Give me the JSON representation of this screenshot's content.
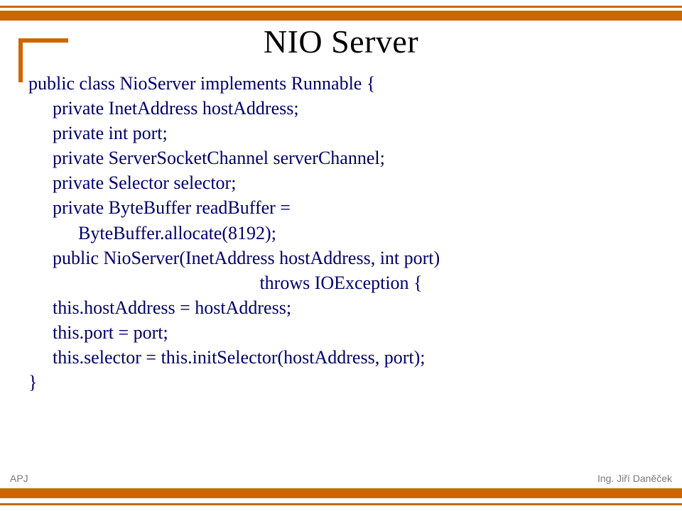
{
  "title": "NIO Server",
  "code": {
    "l1": "public class NioServer implements Runnable {",
    "l2": "private InetAddress hostAddress;",
    "l3": "private int port;",
    "l4": "private ServerSocketChannel serverChannel;",
    "l5": "private Selector selector;",
    "l6": "private ByteBuffer readBuffer =",
    "l7": "ByteBuffer.allocate(8192);",
    "l8": "public NioServer(InetAddress hostAddress, int port)",
    "l9": "throws IOException {",
    "l10": "this.hostAddress = hostAddress;",
    "l11": "this.port = port;",
    "l12": "this.selector = this.initSelector(hostAddress, port);",
    "l13": "}"
  },
  "footer": {
    "left": "APJ",
    "right": "Ing. Jiří Daněček"
  }
}
